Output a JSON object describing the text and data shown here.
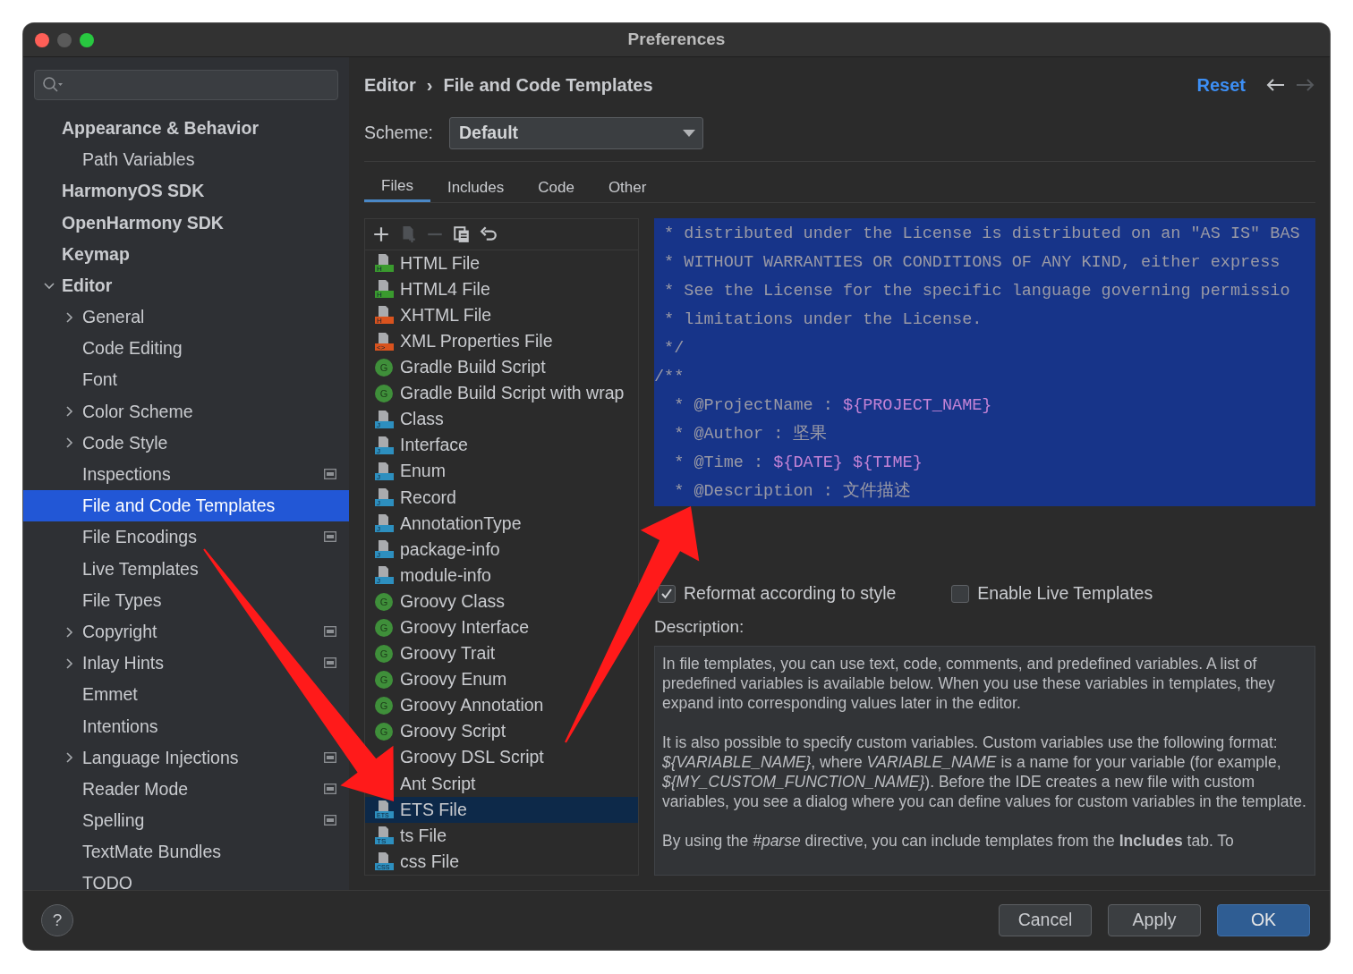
{
  "window": {
    "title": "Preferences"
  },
  "sidebar": {
    "items": [
      {
        "label": "Appearance & Behavior",
        "selected": false,
        "children": [
          {
            "label": "Path Variables",
            "selected": false
          }
        ]
      },
      {
        "label": "HarmonyOS SDK",
        "selected": false
      },
      {
        "label": "OpenHarmony SDK",
        "selected": false
      },
      {
        "label": "Keymap",
        "selected": false
      },
      {
        "label": "Editor",
        "selected": false,
        "expanded": true,
        "children": [
          {
            "label": "General",
            "selected": false,
            "expanded": false,
            "scoped": false
          },
          {
            "label": "Code Editing",
            "selected": false,
            "scoped": false
          },
          {
            "label": "Font",
            "selected": false,
            "scoped": false
          },
          {
            "label": "Color Scheme",
            "selected": false,
            "expanded": false,
            "scoped": false
          },
          {
            "label": "Code Style",
            "selected": false,
            "expanded": false,
            "scoped": false
          },
          {
            "label": "Inspections",
            "selected": false,
            "scoped": true
          },
          {
            "label": "File and Code Templates",
            "selected": true,
            "scoped": false
          },
          {
            "label": "File Encodings",
            "selected": false,
            "scoped": true
          },
          {
            "label": "Live Templates",
            "selected": false,
            "scoped": false
          },
          {
            "label": "File Types",
            "selected": false,
            "scoped": false
          },
          {
            "label": "Copyright",
            "selected": false,
            "expanded": false,
            "scoped": true
          },
          {
            "label": "Inlay Hints",
            "selected": false,
            "expanded": false,
            "scoped": true
          },
          {
            "label": "Emmet",
            "selected": false,
            "scoped": false
          },
          {
            "label": "Intentions",
            "selected": false,
            "scoped": false
          },
          {
            "label": "Language Injections",
            "selected": false,
            "expanded": false,
            "scoped": true
          },
          {
            "label": "Reader Mode",
            "selected": false,
            "scoped": true
          },
          {
            "label": "Spelling",
            "selected": false,
            "scoped": true
          },
          {
            "label": "TextMate Bundles",
            "selected": false,
            "scoped": false
          },
          {
            "label": "TODO",
            "selected": false,
            "scoped": false
          }
        ]
      }
    ]
  },
  "header": {
    "breadcrumb": [
      "Editor",
      "File and Code Templates"
    ],
    "separator": "›",
    "reset": "Reset",
    "nav": [
      {
        "kind": "back",
        "disabled": false
      },
      {
        "kind": "forward",
        "disabled": true
      }
    ]
  },
  "scheme": {
    "label": "Scheme:",
    "value": "Default"
  },
  "tabs": [
    {
      "label": "Files",
      "selected": true
    },
    {
      "label": "Includes",
      "selected": false
    },
    {
      "label": "Code",
      "selected": false
    },
    {
      "label": "Other",
      "selected": false
    }
  ],
  "toolbar": [
    {
      "kind": "add",
      "disabled": false
    },
    {
      "kind": "copy-file",
      "disabled": true
    },
    {
      "kind": "remove",
      "disabled": true
    },
    {
      "kind": "duplicate",
      "disabled": false
    },
    {
      "kind": "reset",
      "disabled": false
    }
  ],
  "templates": [
    {
      "label": "HTML File",
      "kind": "file",
      "badge": "H",
      "color": "#3a9a2e",
      "selected": false
    },
    {
      "label": "HTML4 File",
      "kind": "file",
      "badge": "H",
      "color": "#3a9a2e",
      "selected": false
    },
    {
      "label": "XHTML File",
      "kind": "file",
      "badge": "H",
      "color": "#d9531e",
      "selected": false
    },
    {
      "label": "XML Properties File",
      "kind": "file",
      "badge": "<>",
      "color": "#d9531e",
      "selected": false
    },
    {
      "label": "Gradle Build Script",
      "kind": "groovy",
      "badge": "G",
      "color": "#3f8f3a",
      "selected": false
    },
    {
      "label": "Gradle Build Script with wrap",
      "kind": "groovy",
      "badge": "G",
      "color": "#3f8f3a",
      "selected": false
    },
    {
      "label": "Class",
      "kind": "file",
      "badge": "J",
      "color": "#2d8fbf",
      "selected": false
    },
    {
      "label": "Interface",
      "kind": "file",
      "badge": "J",
      "color": "#2d8fbf",
      "selected": false
    },
    {
      "label": "Enum",
      "kind": "file",
      "badge": "J",
      "color": "#2d8fbf",
      "selected": false
    },
    {
      "label": "Record",
      "kind": "file",
      "badge": "J",
      "color": "#2d8fbf",
      "selected": false
    },
    {
      "label": "AnnotationType",
      "kind": "file",
      "badge": "J",
      "color": "#2d8fbf",
      "selected": false
    },
    {
      "label": "package-info",
      "kind": "file",
      "badge": "J",
      "color": "#2d8fbf",
      "selected": false
    },
    {
      "label": "module-info",
      "kind": "file",
      "badge": "J",
      "color": "#2d8fbf",
      "selected": false
    },
    {
      "label": "Groovy Class",
      "kind": "groovy",
      "badge": "G",
      "color": "#3f8f3a",
      "selected": false
    },
    {
      "label": "Groovy Interface",
      "kind": "groovy",
      "badge": "G",
      "color": "#3f8f3a",
      "selected": false
    },
    {
      "label": "Groovy Trait",
      "kind": "groovy",
      "badge": "G",
      "color": "#3f8f3a",
      "selected": false
    },
    {
      "label": "Groovy Enum",
      "kind": "groovy",
      "badge": "G",
      "color": "#3f8f3a",
      "selected": false
    },
    {
      "label": "Groovy Annotation",
      "kind": "groovy",
      "badge": "G",
      "color": "#3f8f3a",
      "selected": false
    },
    {
      "label": "Groovy Script",
      "kind": "groovy",
      "badge": "G",
      "color": "#3f8f3a",
      "selected": false
    },
    {
      "label": "Groovy DSL Script",
      "kind": "plain",
      "selected": false
    },
    {
      "label": "Ant Script",
      "kind": "plain",
      "selected": false
    },
    {
      "label": "ETS File",
      "kind": "file",
      "badge": "ETS",
      "color": "#2d8fbf",
      "selected": true
    },
    {
      "label": "ts File",
      "kind": "file",
      "badge": "TS",
      "color": "#2d8fbf",
      "selected": false
    },
    {
      "label": "css File",
      "kind": "file",
      "badge": "CSS",
      "color": "#2d8fbf",
      "selected": false
    }
  ],
  "code_lines": [
    [
      {
        "text": " * distributed under the License is distributed on an \"AS IS\" BAS",
        "kind": "comment"
      }
    ],
    [
      {
        "text": " * WITHOUT WARRANTIES OR CONDITIONS OF ANY KIND, either express",
        "kind": "comment"
      }
    ],
    [
      {
        "text": " * See the License for the specific language governing permissio",
        "kind": "comment"
      }
    ],
    [
      {
        "text": " * limitations under the License.",
        "kind": "comment"
      }
    ],
    [
      {
        "text": " */",
        "kind": "comment"
      }
    ],
    [
      {
        "text": "/**",
        "kind": "comment"
      }
    ],
    [
      {
        "text": "  * @ProjectName : ",
        "kind": "comment"
      },
      {
        "text": "${PROJECT_NAME}",
        "kind": "variable"
      }
    ],
    [
      {
        "text": "  * @Author : 坚果",
        "kind": "comment"
      }
    ],
    [
      {
        "text": "  * @Time : ",
        "kind": "comment"
      },
      {
        "text": "${DATE} ${TIME}",
        "kind": "variable"
      }
    ],
    [
      {
        "text": "  * @Description : 文件描述",
        "kind": "comment"
      }
    ]
  ],
  "options": [
    {
      "label": "Reformat according to style",
      "checked": true
    },
    {
      "label": "Enable Live Templates",
      "checked": false
    }
  ],
  "description": {
    "label": "Description:",
    "paragraphs": [
      "In file templates, you can use text, code, comments, and predefined variables. A list of predefined variables is available below. When you use these variables in templates, they expand into corresponding values later in the editor.",
      "It is also possible to specify custom variables. Custom variables use the following format: *${VARIABLE_NAME}*, where *VARIABLE_NAME* is a name for your variable (for example, *${MY_CUSTOM_FUNCTION_NAME}*). Before the IDE creates a new file with custom variables, you see a dialog where you can define values for custom variables in the template.",
      "By using the *#parse* directive, you can include templates from the **Includes** tab. To"
    ]
  },
  "footer": {
    "help": "?",
    "buttons": [
      {
        "label": "Cancel",
        "kind": "default"
      },
      {
        "label": "Apply",
        "kind": "default"
      },
      {
        "label": "OK",
        "kind": "primary"
      }
    ]
  },
  "annotations": [
    {
      "kind": "arrow"
    },
    {
      "kind": "arrow"
    }
  ]
}
